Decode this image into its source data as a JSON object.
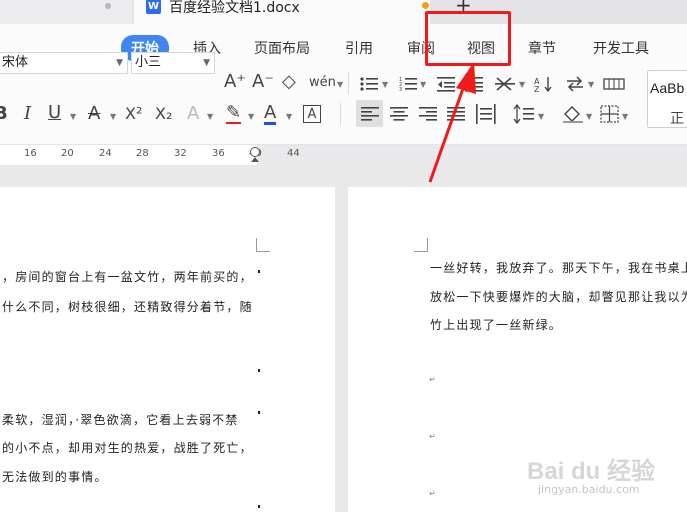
{
  "tabs": {
    "document_title": "百度经验文档1.docx",
    "doc_icon": "W",
    "new_tab": "+"
  },
  "menu": [
    "开始",
    "插入",
    "页面布局",
    "引用",
    "审阅",
    "视图",
    "章节",
    "开发工具"
  ],
  "font": {
    "name": "宋体",
    "size": "小三"
  },
  "toolbar": {
    "row1": [
      "font-grow-icon",
      "font-shrink-icon",
      "clear-format-icon",
      "phonetic-icon",
      "bullet-list-icon",
      "numbered-list-icon",
      "indent-decrease-icon",
      "indent-increase-icon",
      "sort-icon",
      "line-break-icon",
      "table-border-icon"
    ],
    "row2": [
      "bold-icon",
      "italic-icon",
      "underline-icon",
      "strikethrough-icon",
      "superscript-icon",
      "subscript-icon",
      "text-effect-icon",
      "highlight-icon",
      "font-color-icon",
      "char-border-icon",
      "align-left-icon",
      "align-center-icon",
      "align-right-icon",
      "justify-icon",
      "distribute-icon",
      "line-spacing-icon",
      "shading-icon",
      "border-icon"
    ],
    "glyphs": {
      "grow": "A⁺",
      "shrink": "A⁻",
      "clear": "◇",
      "phonetic": "wén",
      "bold": "B",
      "italic": "I",
      "underline": "U",
      "strike": "A",
      "sup": "X²",
      "sub": "X₂",
      "effect": "A",
      "highlight": "✎",
      "fontcolor": "A",
      "charborder": "A"
    },
    "style_sample": "AaBb",
    "style_name": "正"
  },
  "ruler": [
    "16",
    "20",
    "24",
    "28",
    "32",
    "36",
    "40",
    "44"
  ],
  "page_left": {
    "lines": [
      "，房间的窗台上有一盆文竹，两年前买的，",
      "什么不同，树枝很细，还精致得分着节，随",
      "柔软，湿润，·翠色欲滴，它看上去弱不禁",
      "的小不点，却用对生的热爱，战胜了死亡，",
      "无法做到的事情。"
    ]
  },
  "page_right": {
    "lines": [
      "一丝好转，我放弃了。那天下午，我在书桌上",
      "放松一下快要爆炸的大脑，却瞥见那让我以为",
      "竹上出现了一丝新绿。"
    ]
  },
  "watermark": {
    "main": "Bai du 经验",
    "sub": "jingyan.baidu.com"
  },
  "colors": {
    "accent": "#3f86f1",
    "highlight_red": "#f01a1a"
  }
}
